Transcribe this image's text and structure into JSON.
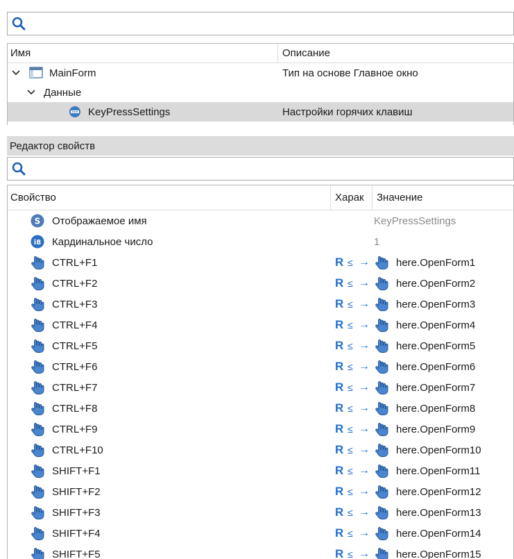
{
  "top_search": {
    "placeholder": ""
  },
  "tree": {
    "columns": {
      "name": "Имя",
      "description": "Описание"
    },
    "rows": [
      {
        "name": "MainForm",
        "description": "Тип на основе Главное окно"
      },
      {
        "name": "Данные",
        "description": ""
      },
      {
        "name": "KeyPressSettings",
        "description": "Настройки горячих клавиш"
      }
    ]
  },
  "editor": {
    "title": "Редактор свойств",
    "search_placeholder": "",
    "columns": {
      "property": "Свойство",
      "characteristics": "Харак",
      "value": "Значение"
    },
    "static_rows": [
      {
        "badge": "S",
        "name": "Отображаемое имя",
        "value": "KeyPressSettings"
      },
      {
        "badge": "i8",
        "name": "Кардинальное число",
        "value": "1"
      }
    ],
    "hotkey_rows": [
      {
        "name": "CTRL+F1",
        "r": "R",
        "le": "≤",
        "arrow": "→",
        "value": "here.OpenForm1"
      },
      {
        "name": "CTRL+F2",
        "r": "R",
        "le": "≤",
        "arrow": "→",
        "value": "here.OpenForm2"
      },
      {
        "name": "CTRL+F3",
        "r": "R",
        "le": "≤",
        "arrow": "→",
        "value": "here.OpenForm3"
      },
      {
        "name": "CTRL+F4",
        "r": "R",
        "le": "≤",
        "arrow": "→",
        "value": "here.OpenForm4"
      },
      {
        "name": "CTRL+F5",
        "r": "R",
        "le": "≤",
        "arrow": "→",
        "value": "here.OpenForm5"
      },
      {
        "name": "CTRL+F6",
        "r": "R",
        "le": "≤",
        "arrow": "→",
        "value": "here.OpenForm6"
      },
      {
        "name": "CTRL+F7",
        "r": "R",
        "le": "≤",
        "arrow": "→",
        "value": "here.OpenForm7"
      },
      {
        "name": "CTRL+F8",
        "r": "R",
        "le": "≤",
        "arrow": "→",
        "value": "here.OpenForm8"
      },
      {
        "name": "CTRL+F9",
        "r": "R",
        "le": "≤",
        "arrow": "→",
        "value": "here.OpenForm9"
      },
      {
        "name": "CTRL+F10",
        "r": "R",
        "le": "≤",
        "arrow": "→",
        "value": "here.OpenForm10"
      },
      {
        "name": "SHIFT+F1",
        "r": "R",
        "le": "≤",
        "arrow": "→",
        "value": "here.OpenForm11"
      },
      {
        "name": "SHIFT+F2",
        "r": "R",
        "le": "≤",
        "arrow": "→",
        "value": "here.OpenForm12"
      },
      {
        "name": "SHIFT+F3",
        "r": "R",
        "le": "≤",
        "arrow": "→",
        "value": "here.OpenForm13"
      },
      {
        "name": "SHIFT+F4",
        "r": "R",
        "le": "≤",
        "arrow": "→",
        "value": "here.OpenForm14"
      },
      {
        "name": "SHIFT+F5",
        "r": "R",
        "le": "≤",
        "arrow": "→",
        "value": "here.OpenForm15"
      }
    ]
  },
  "colors": {
    "accent": "#1f6fd1",
    "selected_row": "#d9d9d9",
    "panel_header": "#dcdcdc"
  }
}
